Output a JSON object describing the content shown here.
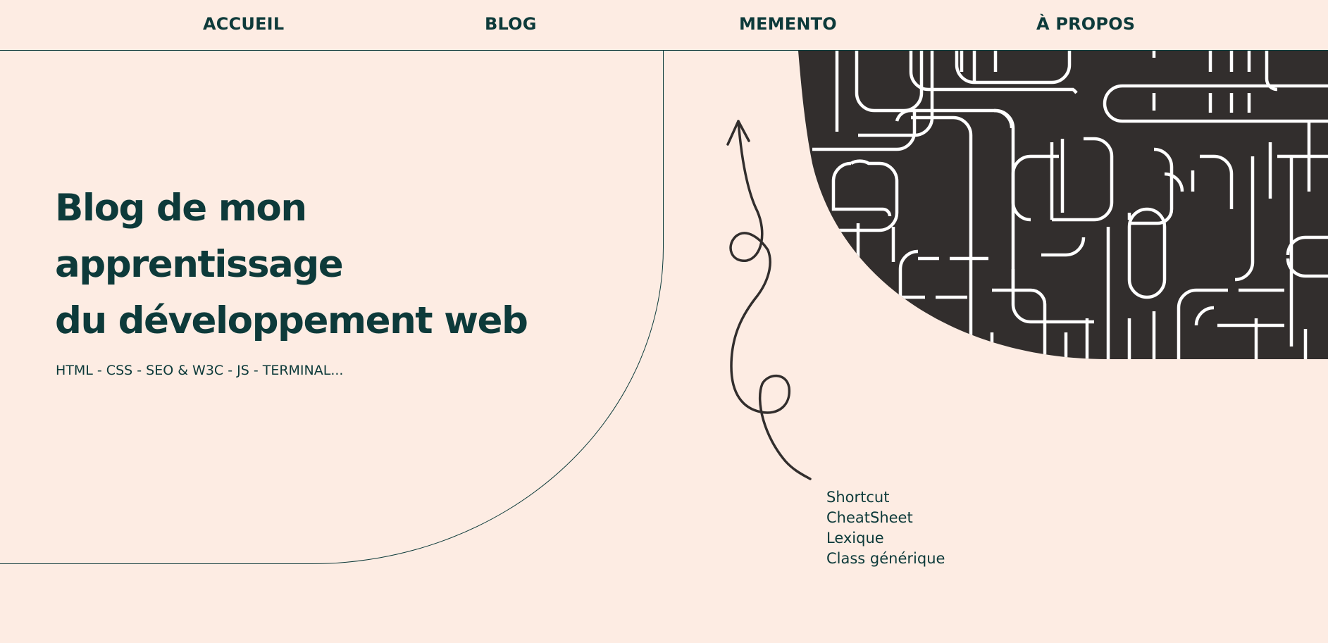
{
  "nav": {
    "items": [
      {
        "label": "ACCUEIL"
      },
      {
        "label": "BLOG"
      },
      {
        "label": "MEMENTO"
      },
      {
        "label": "À PROPOS"
      }
    ]
  },
  "hero": {
    "title_line1": "Blog de mon apprentissage",
    "title_line2": "du développement web",
    "subtitle": "HTML - CSS - SEO & W3C - JS - TERMINAL..."
  },
  "memento": {
    "items": [
      {
        "label": "Shortcut"
      },
      {
        "label": "CheatSheet"
      },
      {
        "label": "Lexique"
      },
      {
        "label": "Class générique"
      }
    ]
  },
  "colors": {
    "background": "#fdece3",
    "text": "#0d3a3a",
    "pattern_bg": "#322e2d",
    "pattern_lines": "#ffffff"
  },
  "icons": {
    "decoration": "hand-drawn-squiggle-arrow-icon",
    "banner": "circuit-pipes-pattern"
  }
}
